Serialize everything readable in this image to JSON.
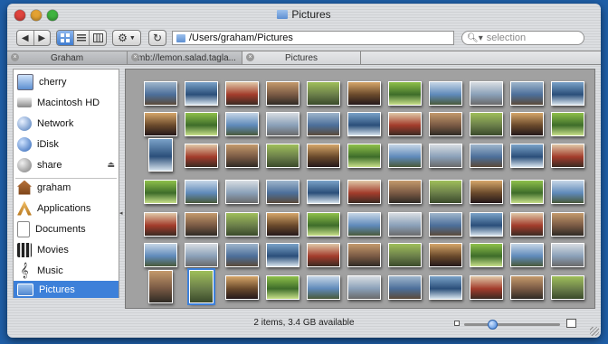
{
  "window": {
    "title": "Pictures",
    "colors": {
      "close": "#e0443e",
      "minimize": "#e3a232",
      "zoom": "#3fb33f",
      "accent": "#3d80d9"
    }
  },
  "toolbar": {
    "back_icon": "chevron-left-icon",
    "forward_icon": "chevron-right-icon",
    "view_modes": [
      "icon-view-icon",
      "list-view-icon",
      "column-view-icon"
    ],
    "active_view": "icon-view-icon",
    "action_icon": "gear-icon",
    "refresh_icon": "refresh-icon",
    "path": "/Users/graham/Pictures",
    "search_placeholder": "selection"
  },
  "tabs": [
    {
      "label": "Graham",
      "active": false
    },
    {
      "label": "smb://lemon.salad.tagla...",
      "active": false
    },
    {
      "label": "Pictures",
      "active": true
    }
  ],
  "sidebar": {
    "devices": [
      {
        "label": "cherry",
        "icon": "computer-icon"
      },
      {
        "label": "Macintosh HD",
        "icon": "hard-drive-icon"
      },
      {
        "label": "Network",
        "icon": "network-globe-icon"
      },
      {
        "label": "iDisk",
        "icon": "idisk-icon"
      },
      {
        "label": "share",
        "icon": "network-share-icon",
        "eject": true
      }
    ],
    "places": [
      {
        "label": "graham",
        "icon": "home-icon"
      },
      {
        "label": "Applications",
        "icon": "applications-icon"
      },
      {
        "label": "Documents",
        "icon": "documents-icon"
      },
      {
        "label": "Movies",
        "icon": "movies-icon"
      },
      {
        "label": "Music",
        "icon": "music-icon"
      },
      {
        "label": "Pictures",
        "icon": "pictures-icon",
        "selected": true
      }
    ]
  },
  "status": "2 items, 3.4 GB available",
  "zoom_slider": {
    "value": 0.3
  }
}
